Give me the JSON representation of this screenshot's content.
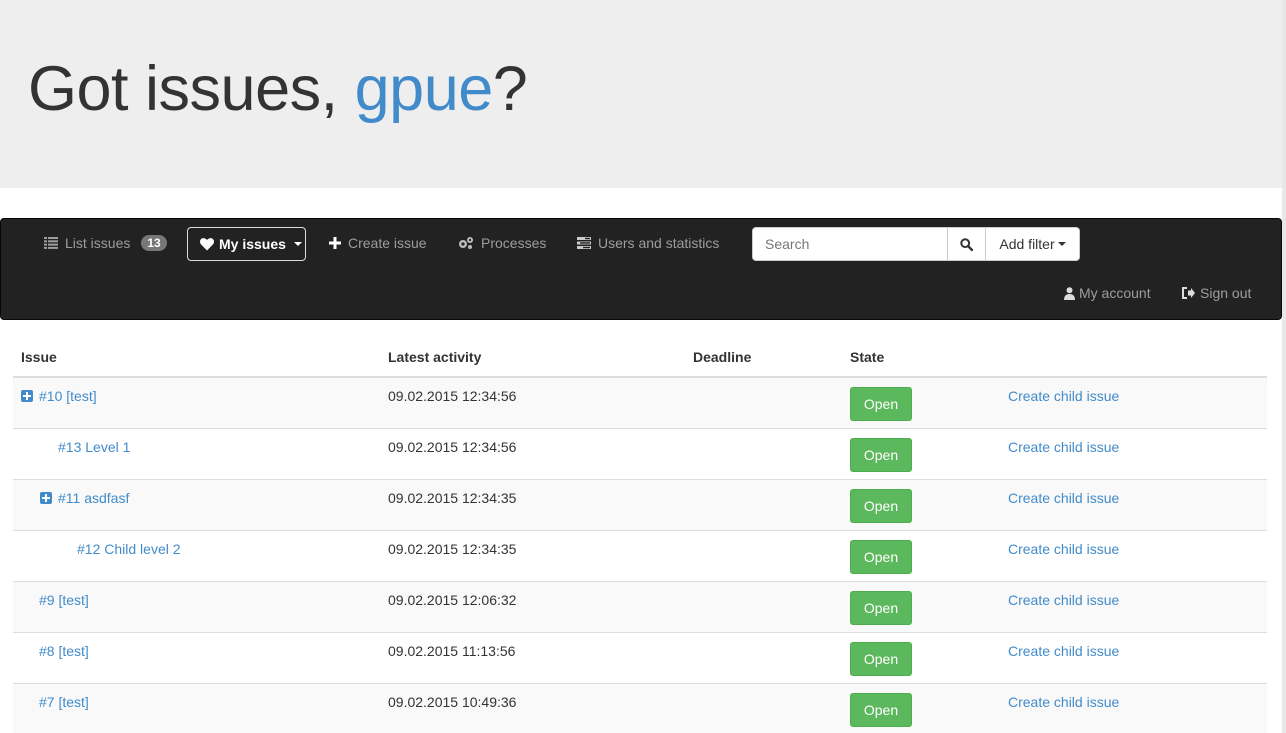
{
  "header": {
    "greeting_prefix": "Got issues, ",
    "username": "gpue",
    "greeting_suffix": "?"
  },
  "nav": {
    "list_issues": "List issues",
    "list_issues_count": "13",
    "my_issues": "My issues",
    "create_issue": "Create issue",
    "processes": "Processes",
    "users_and_statistics": "Users and statistics",
    "search_placeholder": "Search",
    "add_filter": "Add filter",
    "my_account": "My account",
    "sign_out": "Sign out"
  },
  "table": {
    "columns": [
      "Issue",
      "Latest activity",
      "Deadline",
      "State",
      ""
    ],
    "rows": [
      {
        "issue": "#10 [test]",
        "level": 0,
        "expandable": true,
        "activity": "09.02.2015 12:34:56",
        "deadline": "",
        "state": "Open",
        "action": "Create child issue"
      },
      {
        "issue": "#13 Level 1",
        "level": 1,
        "expandable": false,
        "activity": "09.02.2015 12:34:56",
        "deadline": "",
        "state": "Open",
        "action": "Create child issue"
      },
      {
        "issue": "#11 asdfasf",
        "level": 1,
        "expandable": true,
        "activity": "09.02.2015 12:34:35",
        "deadline": "",
        "state": "Open",
        "action": "Create child issue"
      },
      {
        "issue": "#12 Child level 2",
        "level": 2,
        "expandable": false,
        "activity": "09.02.2015 12:34:35",
        "deadline": "",
        "state": "Open",
        "action": "Create child issue"
      },
      {
        "issue": "#9 [test]",
        "level": 0,
        "expandable": false,
        "activity": "09.02.2015 12:06:32",
        "deadline": "",
        "state": "Open",
        "action": "Create child issue"
      },
      {
        "issue": "#8 [test]",
        "level": 0,
        "expandable": false,
        "activity": "09.02.2015 11:13:56",
        "deadline": "",
        "state": "Open",
        "action": "Create child issue"
      },
      {
        "issue": "#7 [test]",
        "level": 0,
        "expandable": false,
        "activity": "09.02.2015 10:49:36",
        "deadline": "",
        "state": "Open",
        "action": "Create child issue"
      }
    ]
  },
  "colors": {
    "brand": "#428bca",
    "navbar_bg": "#222222",
    "success": "#5cb85c",
    "jumbotron_bg": "#eeeeee"
  }
}
